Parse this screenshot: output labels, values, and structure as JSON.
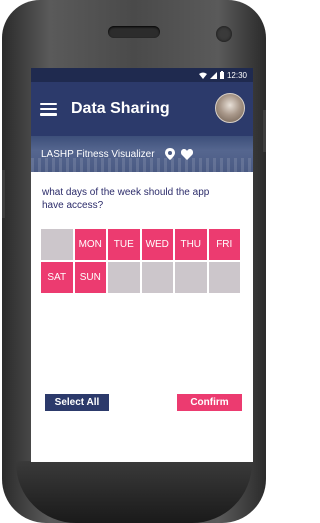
{
  "status": {
    "time": "12:30",
    "wifi_icon": "wifi-icon",
    "signal_icon": "signal-icon",
    "battery_icon": "battery-icon"
  },
  "appbar": {
    "title": "Data Sharing",
    "menu_icon": "menu-icon"
  },
  "subbar": {
    "label": "LASHP Fitness Visualizer",
    "location_icon": "location-icon",
    "heart_icon": "heart-icon"
  },
  "question": "what days of the week should the app have access?",
  "days": [
    {
      "label": "",
      "selected": false
    },
    {
      "label": "MON",
      "selected": true
    },
    {
      "label": "TUE",
      "selected": true
    },
    {
      "label": "WED",
      "selected": true
    },
    {
      "label": "THU",
      "selected": true
    },
    {
      "label": "FRI",
      "selected": true
    },
    {
      "label": "SAT",
      "selected": true
    },
    {
      "label": "SUN",
      "selected": true
    },
    {
      "label": "",
      "selected": false
    },
    {
      "label": "",
      "selected": false
    },
    {
      "label": "",
      "selected": false
    },
    {
      "label": "",
      "selected": false
    }
  ],
  "buttons": {
    "select_all": "Select All",
    "confirm": "Confirm"
  },
  "colors": {
    "primary": "#2c3a6b",
    "accent": "#ec3b70",
    "unselected": "#ccc6cb"
  }
}
